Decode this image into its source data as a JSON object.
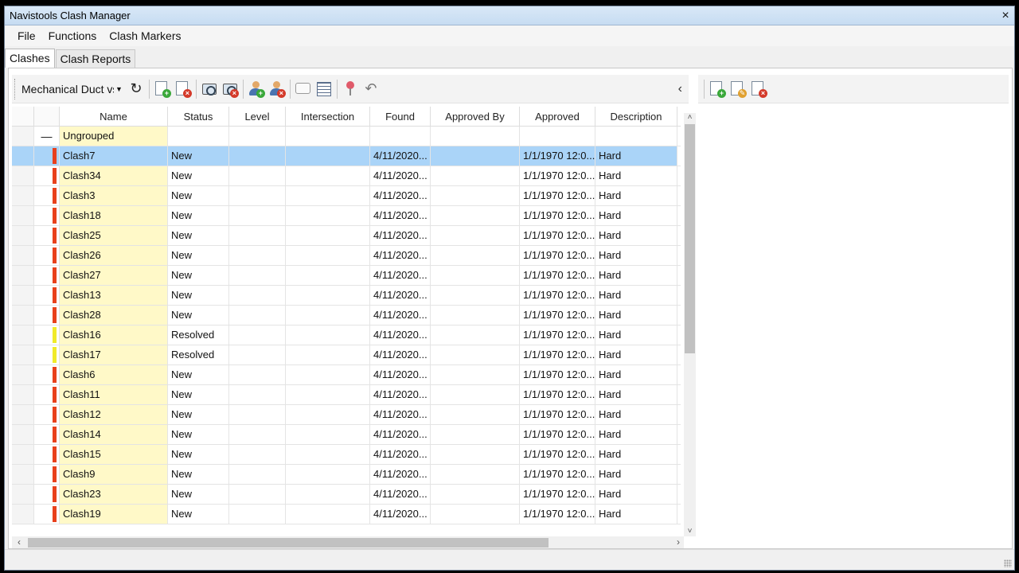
{
  "window": {
    "title": "Navistools Clash Manager",
    "close_glyph": "×"
  },
  "menu": [
    "File",
    "Functions",
    "Clash Markers"
  ],
  "tabs": [
    {
      "label": "Clashes",
      "active": true
    },
    {
      "label": "Clash Reports",
      "active": false
    }
  ],
  "toolbar": {
    "test_select_value": "Mechanical Duct vs",
    "collapse_glyph": "‹",
    "icons": [
      "refresh-icon",
      "add-clash-icon",
      "delete-clash-icon",
      "take-snapshot-icon",
      "delete-snapshot-icon",
      "assign-user-icon",
      "remove-user-icon",
      "comment-icon",
      "table-icon",
      "marker-pin-icon",
      "undo-icon"
    ]
  },
  "right_toolbar": {
    "icons": [
      "add-item-icon",
      "edit-item-icon",
      "delete-item-icon"
    ]
  },
  "grid": {
    "columns": [
      "Name",
      "Status",
      "Level",
      "Intersection",
      "Found",
      "Approved By",
      "Approved",
      "Description"
    ],
    "group": {
      "toggle": "—",
      "label": "Ungrouped"
    },
    "status_colors": {
      "New": "#e8401c",
      "Resolved": "#f0ea2a"
    },
    "rows": [
      {
        "name": "Clash7",
        "status": "New",
        "level": "",
        "intersection": "",
        "found": "4/11/2020...",
        "approved_by": "",
        "approved": "1/1/1970 12:0...",
        "description": "Hard",
        "selected": true
      },
      {
        "name": "Clash34",
        "status": "New",
        "level": "",
        "intersection": "",
        "found": "4/11/2020...",
        "approved_by": "",
        "approved": "1/1/1970 12:0...",
        "description": "Hard"
      },
      {
        "name": "Clash3",
        "status": "New",
        "level": "",
        "intersection": "",
        "found": "4/11/2020...",
        "approved_by": "",
        "approved": "1/1/1970 12:0...",
        "description": "Hard"
      },
      {
        "name": "Clash18",
        "status": "New",
        "level": "",
        "intersection": "",
        "found": "4/11/2020...",
        "approved_by": "",
        "approved": "1/1/1970 12:0...",
        "description": "Hard"
      },
      {
        "name": "Clash25",
        "status": "New",
        "level": "",
        "intersection": "",
        "found": "4/11/2020...",
        "approved_by": "",
        "approved": "1/1/1970 12:0...",
        "description": "Hard"
      },
      {
        "name": "Clash26",
        "status": "New",
        "level": "",
        "intersection": "",
        "found": "4/11/2020...",
        "approved_by": "",
        "approved": "1/1/1970 12:0...",
        "description": "Hard"
      },
      {
        "name": "Clash27",
        "status": "New",
        "level": "",
        "intersection": "",
        "found": "4/11/2020...",
        "approved_by": "",
        "approved": "1/1/1970 12:0...",
        "description": "Hard"
      },
      {
        "name": "Clash13",
        "status": "New",
        "level": "",
        "intersection": "",
        "found": "4/11/2020...",
        "approved_by": "",
        "approved": "1/1/1970 12:0...",
        "description": "Hard"
      },
      {
        "name": "Clash28",
        "status": "New",
        "level": "",
        "intersection": "",
        "found": "4/11/2020...",
        "approved_by": "",
        "approved": "1/1/1970 12:0...",
        "description": "Hard"
      },
      {
        "name": "Clash16",
        "status": "Resolved",
        "level": "",
        "intersection": "",
        "found": "4/11/2020...",
        "approved_by": "",
        "approved": "1/1/1970 12:0...",
        "description": "Hard"
      },
      {
        "name": "Clash17",
        "status": "Resolved",
        "level": "",
        "intersection": "",
        "found": "4/11/2020...",
        "approved_by": "",
        "approved": "1/1/1970 12:0...",
        "description": "Hard"
      },
      {
        "name": "Clash6",
        "status": "New",
        "level": "",
        "intersection": "",
        "found": "4/11/2020...",
        "approved_by": "",
        "approved": "1/1/1970 12:0...",
        "description": "Hard"
      },
      {
        "name": "Clash11",
        "status": "New",
        "level": "",
        "intersection": "",
        "found": "4/11/2020...",
        "approved_by": "",
        "approved": "1/1/1970 12:0...",
        "description": "Hard"
      },
      {
        "name": "Clash12",
        "status": "New",
        "level": "",
        "intersection": "",
        "found": "4/11/2020...",
        "approved_by": "",
        "approved": "1/1/1970 12:0...",
        "description": "Hard"
      },
      {
        "name": "Clash14",
        "status": "New",
        "level": "",
        "intersection": "",
        "found": "4/11/2020...",
        "approved_by": "",
        "approved": "1/1/1970 12:0...",
        "description": "Hard"
      },
      {
        "name": "Clash15",
        "status": "New",
        "level": "",
        "intersection": "",
        "found": "4/11/2020...",
        "approved_by": "",
        "approved": "1/1/1970 12:0...",
        "description": "Hard"
      },
      {
        "name": "Clash9",
        "status": "New",
        "level": "",
        "intersection": "",
        "found": "4/11/2020...",
        "approved_by": "",
        "approved": "1/1/1970 12:0...",
        "description": "Hard"
      },
      {
        "name": "Clash23",
        "status": "New",
        "level": "",
        "intersection": "",
        "found": "4/11/2020...",
        "approved_by": "",
        "approved": "1/1/1970 12:0...",
        "description": "Hard"
      },
      {
        "name": "Clash19",
        "status": "New",
        "level": "",
        "intersection": "",
        "found": "4/11/2020...",
        "approved_by": "",
        "approved": "1/1/1970 12:0...",
        "description": "Hard"
      }
    ]
  },
  "scrollbars": {
    "up": "˄",
    "down": "˅",
    "left": "‹",
    "right": "›"
  }
}
